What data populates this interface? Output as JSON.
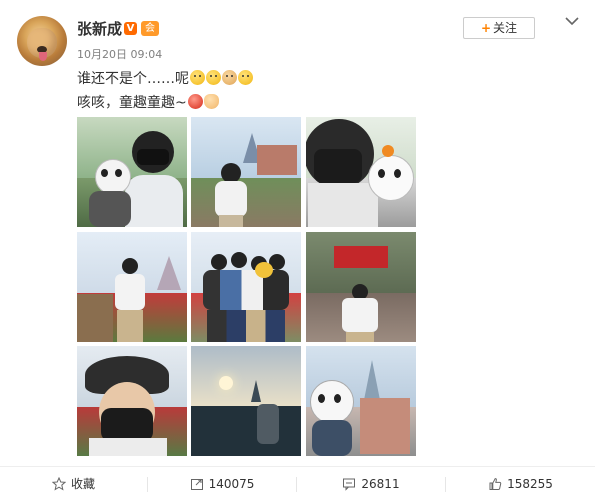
{
  "post": {
    "user_name": "张新成",
    "verified_badge": "V",
    "vip_badge": "会",
    "time": "10月20日 09:04",
    "follow_label": "关注",
    "text_line1": "谁还不是个……呢",
    "text_line2": "咳咳，童趣童趣~",
    "emoji_line1": [
      "proud-face-emoji",
      "smirk-face-emoji",
      "monkey-emoji",
      "thinking-emoji"
    ],
    "emoji_line2": [
      "red-bird-emoji",
      "victory-hand-emoji"
    ]
  },
  "photos": [
    "selfie-with-jack-plush",
    "standing-at-castle",
    "closeup-with-plush",
    "park-flowerbed",
    "group-photo",
    "marvel-entrance",
    "bucket-hat-selfie",
    "castle-sunset",
    "plush-and-castle"
  ],
  "actions": {
    "favorite_label": "收藏",
    "repost_count": "140075",
    "comment_count": "26811",
    "like_count": "158255"
  },
  "colors": {
    "accent": "#ff8200",
    "text": "#333333",
    "muted": "#808080",
    "vip": "#ff9a2a",
    "verified": "#ff6a00"
  }
}
